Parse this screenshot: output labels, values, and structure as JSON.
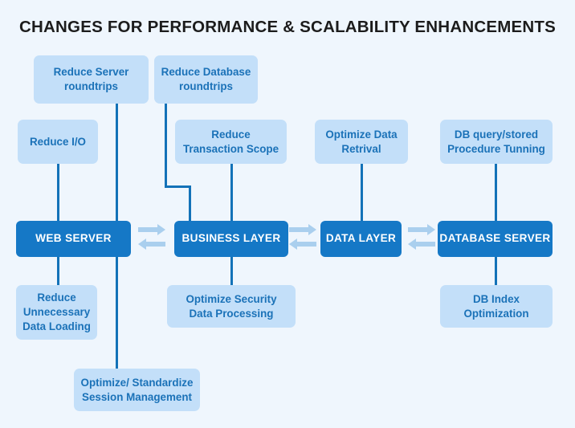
{
  "title": "CHANGES FOR PERFORMANCE & SCALABILITY ENHANCEMENTS",
  "colors": {
    "background": "#eff6fd",
    "core_box_fill": "#1578c6",
    "core_box_text": "#ffffff",
    "leaf_box_fill": "#c3dff9",
    "leaf_box_text": "#1b72b8",
    "connector_line": "#1372b8",
    "arrow_fill": "#aacfee",
    "title_text": "#1c1c1c"
  },
  "core_layers": [
    {
      "id": "web-server",
      "label": "WEB SERVER"
    },
    {
      "id": "business-layer",
      "label": "BUSINESS LAYER"
    },
    {
      "id": "data-layer",
      "label": "DATA LAYER"
    },
    {
      "id": "database-server",
      "label": "DATABASE SERVER"
    }
  ],
  "leaf_nodes": [
    {
      "id": "reduce-server-roundtrips",
      "lines": [
        "Reduce Server",
        "roundtrips"
      ],
      "attached_to": "web-server",
      "position": "above"
    },
    {
      "id": "reduce-io",
      "lines": [
        "Reduce I/O"
      ],
      "attached_to": "web-server",
      "position": "above"
    },
    {
      "id": "reduce-database-roundtrips",
      "lines": [
        "Reduce Database",
        "roundtrips"
      ],
      "attached_to": "business-layer",
      "position": "above"
    },
    {
      "id": "reduce-transaction-scope",
      "lines": [
        "Reduce",
        "Transaction Scope"
      ],
      "attached_to": "business-layer",
      "position": "above"
    },
    {
      "id": "optimize-data-retrival",
      "lines": [
        "Optimize Data",
        "Retrival"
      ],
      "attached_to": "data-layer",
      "position": "above"
    },
    {
      "id": "db-query-stored-procedure-tunning",
      "lines": [
        "DB query/stored",
        "Procedure Tunning"
      ],
      "attached_to": "database-server",
      "position": "above"
    },
    {
      "id": "reduce-unnecessary-data-loading",
      "lines": [
        "Reduce",
        "Unnecessary",
        "Data Loading"
      ],
      "attached_to": "web-server",
      "position": "below"
    },
    {
      "id": "optimize-security-data-processing",
      "lines": [
        "Optimize Security",
        "Data Processing"
      ],
      "attached_to": "business-layer",
      "position": "below"
    },
    {
      "id": "db-index-optimization",
      "lines": [
        "DB Index",
        "Optimization"
      ],
      "attached_to": "database-server",
      "position": "below"
    },
    {
      "id": "optimize-standardize-session-management",
      "lines": [
        "Optimize/ Standardize",
        "Session Management"
      ],
      "attached_to": "web-server",
      "position": "below"
    }
  ],
  "flow_connectors": [
    {
      "id": "web-to-business",
      "from": "WEB SERVER",
      "to": "BUSINESS LAYER",
      "type": "bidirectional"
    },
    {
      "id": "business-to-data",
      "from": "BUSINESS LAYER",
      "to": "DATA LAYER",
      "type": "bidirectional"
    },
    {
      "id": "data-to-database",
      "from": "DATA LAYER",
      "to": "DATABASE SERVER",
      "type": "bidirectional"
    }
  ]
}
